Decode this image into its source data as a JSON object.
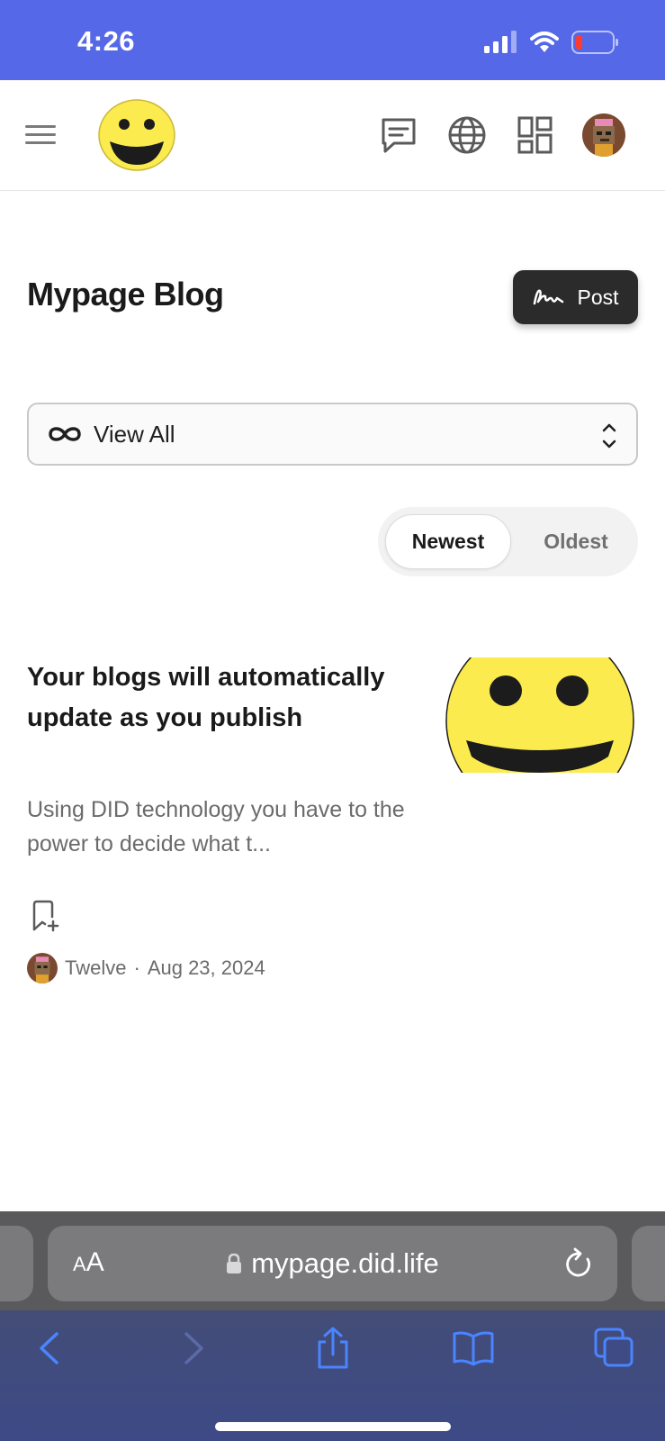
{
  "status_bar": {
    "time": "4:26"
  },
  "header": {
    "icons": [
      "menu-icon",
      "smiley-logo",
      "chat-icon",
      "globe-icon",
      "grid-icon",
      "avatar"
    ]
  },
  "page": {
    "title": "Mypage Blog",
    "post_button_label": "Post",
    "filter": {
      "selected": "View All"
    },
    "sort": {
      "newest_label": "Newest",
      "oldest_label": "Oldest",
      "active": "Newest"
    }
  },
  "posts": [
    {
      "title": "Your blogs will automatically update as you publish",
      "excerpt": "Using DID technology you have to the power to decide what t...",
      "author": "Twelve",
      "separator": "·",
      "date": "Aug 23, 2024"
    }
  ],
  "browser": {
    "aa_small": "A",
    "aa_big": "A",
    "url": "mypage.did.life"
  },
  "colors": {
    "status_bar": "#5468E8",
    "post_button": "#2b2b2b",
    "smiley_yellow": "#FBEB4E",
    "safari_accent": "#4A84FF"
  }
}
